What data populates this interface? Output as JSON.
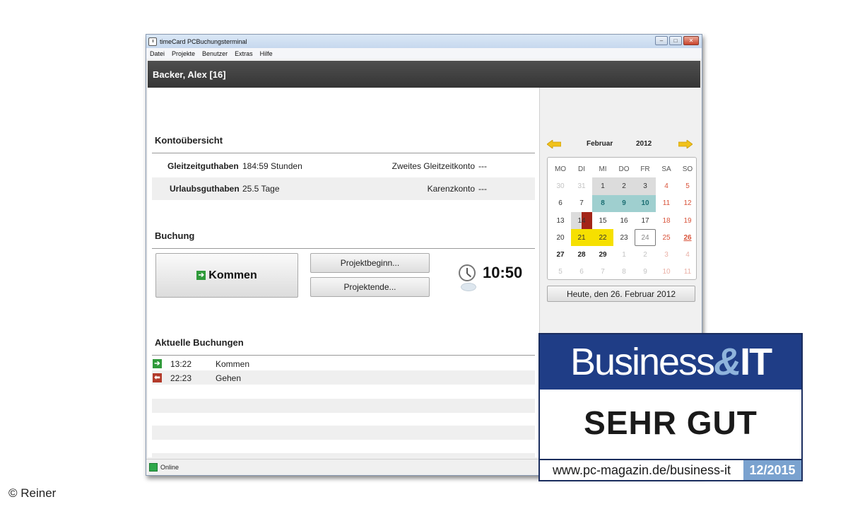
{
  "window": {
    "title": "timeCard PCBuchungsterminal",
    "minimize": "–",
    "maximize": "□",
    "close": "✕"
  },
  "menu": [
    "Datei",
    "Projekte",
    "Benutzer",
    "Extras",
    "Hilfe"
  ],
  "user": {
    "name": "Backer, Alex [16]"
  },
  "konto": {
    "title": "Kontoübersicht",
    "rows": [
      {
        "label": "Gleitzeitguthaben",
        "value": "184:59 Stunden",
        "right_label": "Zweites Gleitzeitkonto",
        "right_value": "---"
      },
      {
        "label": "Urlaubsguthaben",
        "value": "25.5 Tage",
        "right_label": "Karenzkonto",
        "right_value": "---"
      }
    ]
  },
  "buchung": {
    "title": "Buchung",
    "kommen_label": "Kommen",
    "projektbeginn_label": "Projektbeginn...",
    "projektende_label": "Projektende...",
    "time": "10:50"
  },
  "aktuelle": {
    "title": "Aktuelle Buchungen",
    "rows": [
      {
        "time": "13:22",
        "action": "Kommen",
        "icon": "arrow-in-icon",
        "color": "#2f9a3a"
      },
      {
        "time": "22:23",
        "action": "Gehen",
        "icon": "arrow-out-icon",
        "color": "#b33a2a"
      }
    ]
  },
  "calendar": {
    "month": "Februar",
    "year": "2012",
    "weekdays": [
      "MO",
      "DI",
      "MI",
      "DO",
      "FR",
      "SA",
      "SO"
    ],
    "weeks": [
      [
        {
          "d": "30",
          "s": "other"
        },
        {
          "d": "31",
          "s": "other"
        },
        {
          "d": "1",
          "s": "grey"
        },
        {
          "d": "2",
          "s": "grey"
        },
        {
          "d": "3",
          "s": "grey"
        },
        {
          "d": "4",
          "s": "weekend"
        },
        {
          "d": "5",
          "s": "weekend"
        }
      ],
      [
        {
          "d": "6",
          "s": "normal"
        },
        {
          "d": "7",
          "s": "normal"
        },
        {
          "d": "8",
          "s": "teal"
        },
        {
          "d": "9",
          "s": "teal"
        },
        {
          "d": "10",
          "s": "teal"
        },
        {
          "d": "11",
          "s": "weekend"
        },
        {
          "d": "12",
          "s": "weekend"
        }
      ],
      [
        {
          "d": "13",
          "s": "normal"
        },
        {
          "d": "14",
          "s": "half-red"
        },
        {
          "d": "15",
          "s": "normal"
        },
        {
          "d": "16",
          "s": "normal"
        },
        {
          "d": "17",
          "s": "normal"
        },
        {
          "d": "18",
          "s": "weekend"
        },
        {
          "d": "19",
          "s": "weekend"
        }
      ],
      [
        {
          "d": "20",
          "s": "normal"
        },
        {
          "d": "21",
          "s": "yellow"
        },
        {
          "d": "22",
          "s": "yellow"
        },
        {
          "d": "23",
          "s": "normal"
        },
        {
          "d": "24",
          "s": "today"
        },
        {
          "d": "25",
          "s": "weekend"
        },
        {
          "d": "26",
          "s": "underline"
        }
      ],
      [
        {
          "d": "27",
          "s": "bold"
        },
        {
          "d": "28",
          "s": "bold"
        },
        {
          "d": "29",
          "s": "bold"
        },
        {
          "d": "1",
          "s": "other"
        },
        {
          "d": "2",
          "s": "other"
        },
        {
          "d": "3",
          "s": "other-we"
        },
        {
          "d": "4",
          "s": "other-we"
        }
      ],
      [
        {
          "d": "5",
          "s": "other"
        },
        {
          "d": "6",
          "s": "other"
        },
        {
          "d": "7",
          "s": "other"
        },
        {
          "d": "8",
          "s": "other"
        },
        {
          "d": "9",
          "s": "other"
        },
        {
          "d": "10",
          "s": "other-we"
        },
        {
          "d": "11",
          "s": "other-we"
        }
      ]
    ],
    "today_button": "Heute, den 26. Februar 2012"
  },
  "status": {
    "text": "Online",
    "color": "#2fa84a"
  },
  "badge": {
    "word1": "Business",
    "amp": "&",
    "word2": "IT",
    "rating": "SEHR GUT",
    "url": "www.pc-magazin.de/business-it",
    "issue": "12/2015"
  },
  "credit": "© Reiner",
  "colors": {
    "accent_teal": "#9fcfcf",
    "highlight_yellow": "#f6e000",
    "weekend_red": "#d9543b",
    "badge_blue": "#1f3d86"
  }
}
